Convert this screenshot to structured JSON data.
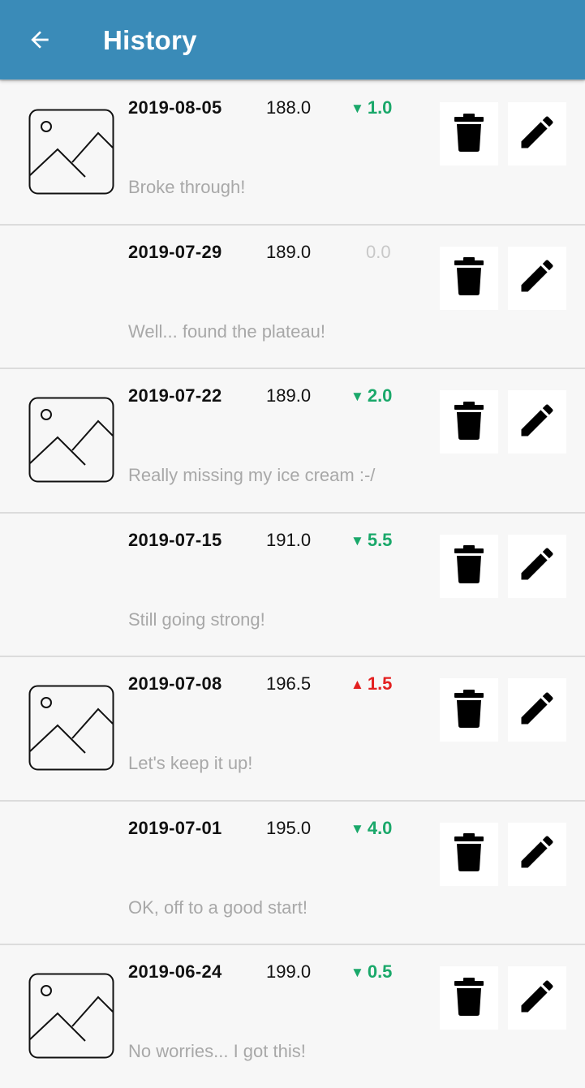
{
  "header": {
    "title": "History",
    "back_icon": "arrow-left-icon",
    "background": "#3a8bb8"
  },
  "colors": {
    "down": "#1aa86a",
    "up": "#e32020",
    "neutral": "#c8c8c8"
  },
  "entries": [
    {
      "date": "2019-08-05",
      "weight": "188.0",
      "direction": "down",
      "arrow": "▼",
      "change": "1.0",
      "note": "Broke through!",
      "has_photo": true
    },
    {
      "date": "2019-07-29",
      "weight": "189.0",
      "direction": "neutral",
      "arrow": "",
      "change": "0.0",
      "note": "Well... found the plateau!",
      "has_photo": false
    },
    {
      "date": "2019-07-22",
      "weight": "189.0",
      "direction": "down",
      "arrow": "▼",
      "change": "2.0",
      "note": "Really missing my ice cream :-/",
      "has_photo": true
    },
    {
      "date": "2019-07-15",
      "weight": "191.0",
      "direction": "down",
      "arrow": "▼",
      "change": "5.5",
      "note": "Still going strong!",
      "has_photo": false
    },
    {
      "date": "2019-07-08",
      "weight": "196.5",
      "direction": "up",
      "arrow": "▲",
      "change": "1.5",
      "note": "Let's keep it up!",
      "has_photo": true
    },
    {
      "date": "2019-07-01",
      "weight": "195.0",
      "direction": "down",
      "arrow": "▼",
      "change": "4.0",
      "note": "OK, off to a good start!",
      "has_photo": false
    },
    {
      "date": "2019-06-24",
      "weight": "199.0",
      "direction": "down",
      "arrow": "▼",
      "change": "0.5",
      "note": "No worries... I got this!",
      "has_photo": true
    }
  ],
  "icons": {
    "delete": "trash-icon",
    "edit": "pencil-icon",
    "photo": "image-placeholder-icon"
  }
}
